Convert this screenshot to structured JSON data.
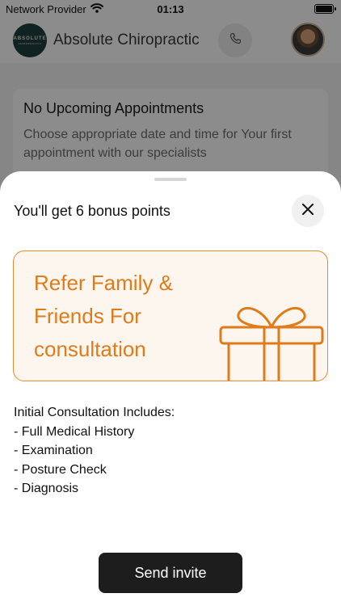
{
  "status_bar": {
    "carrier": "Network Provider",
    "time": "01:13"
  },
  "header": {
    "logo_text": "ABSOLUTE",
    "logo_subtext": "CHIROPRACTIC",
    "title": "Absolute Chiropractic"
  },
  "appointments_card": {
    "title": "No Upcoming Appointments",
    "description": "Choose appropriate date and time for Your first appointment with our specialists"
  },
  "sheet": {
    "title": "You'll get 6 bonus points",
    "promo": {
      "line1": "Refer Family &",
      "line2": "Friends For",
      "line3": "consultation"
    },
    "details": [
      "Initial Consultation Includes:",
      "- Full Medical History",
      "- Examination",
      "- Posture Check",
      "- Diagnosis"
    ],
    "send_button_label": "Send invite"
  },
  "colors": {
    "accent": "#e07b1a",
    "promo_background": "#fdf6ef",
    "button_background": "#1d1d1d",
    "logo_background": "#1f3f3f"
  },
  "icons": {
    "wifi": "wifi-icon",
    "battery": "battery-icon",
    "phone": "phone-icon",
    "close": "close-icon",
    "gift": "gift-icon"
  }
}
